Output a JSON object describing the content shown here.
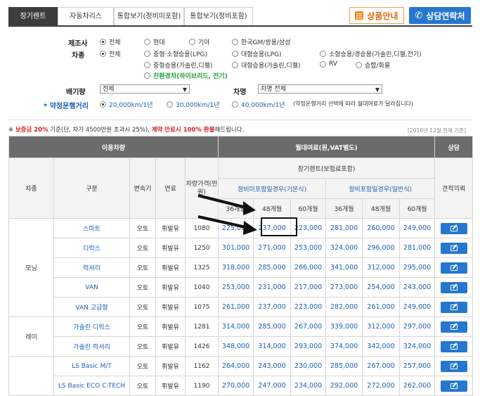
{
  "tabs": [
    {
      "label": "장기렌트",
      "active": true
    },
    {
      "label": "자동차리스",
      "active": false
    },
    {
      "label": "통합보기(정비미포함)",
      "active": false
    },
    {
      "label": "통합보기(정비포함)",
      "active": false
    }
  ],
  "buttons": {
    "product_info": "상품안내",
    "contact": "상담연락처"
  },
  "filters": {
    "maker_label": "제조사",
    "makers": [
      "전체",
      "현대",
      "기아",
      "한국GM/쌍용/삼성"
    ],
    "type_label": "차종",
    "types": [
      "전체",
      "중형·소형승용(LPG)",
      "대형승용(LPG)",
      "소형승용/경승용(가솔린,디젤,전기)",
      "중형승용(가솔린,디젤)",
      "대형승용(가솔린,디젤)",
      "RV",
      "승합/화물",
      "친환경차(하이브리드, 전기)"
    ],
    "displacement_label": "배기량",
    "displacement_value": "전체",
    "model_label": "차명",
    "model_value": "차명 전체",
    "mileage_label": "약정운행거리",
    "mileage_options": [
      "20,000km/1년",
      "30,000km/1년",
      "40,000km/1년"
    ],
    "mileage_note": "(약정운행거리 선택에 따라 월대여료가 달라집니다)"
  },
  "notice": {
    "prefix": "※ ",
    "deposit": "보증금 20%",
    "mid": " 기준(단, 차가 4500만원 초과시 25%), ",
    "refund": "계약 만료시 100% 환불",
    "suffix": "해드립니다.",
    "date": "[2016년 12월 현재 기준]"
  },
  "table": {
    "h_vehicle": "이용차량",
    "h_rent": "월대여료(원,VAT별도)",
    "h_consult": "상담",
    "h_longterm": "장기렌트(보험료포함)",
    "col_type": "차종",
    "col_grade": "구분",
    "col_trans": "변속기",
    "col_fuel": "연료",
    "col_price": "차량가격(만원)",
    "col_no_maint": "정비미포함일경우(기본식)",
    "col_maint": "정비포함일경우(일반식)",
    "col_estimate": "견적의뢰",
    "months": [
      "36개월",
      "48개월",
      "60개월",
      "36개월",
      "48개월",
      "60개월"
    ],
    "groups": [
      {
        "type": "모닝",
        "rows": [
          {
            "grade": "스마트",
            "trans": "오토",
            "fuel": "휘발유",
            "price": "1080",
            "p": [
              "225,000",
              "237,000",
              "223,000",
              "281,000",
              "260,000",
              "249,000"
            ]
          },
          {
            "grade": "디럭스",
            "trans": "오토",
            "fuel": "휘발유",
            "price": "1250",
            "p": [
              "301,000",
              "271,000",
              "253,000",
              "324,000",
              "296,000",
              "281,000"
            ]
          },
          {
            "grade": "럭셔리",
            "trans": "오토",
            "fuel": "휘발유",
            "price": "1325",
            "p": [
              "318,000",
              "285,000",
              "266,000",
              "341,000",
              "312,000",
              "295,000"
            ]
          },
          {
            "grade": "VAN",
            "trans": "오토",
            "fuel": "휘발유",
            "price": "1040",
            "p": [
              "253,000",
              "231,000",
              "217,000",
              "273,000",
              "254,000",
              "243,000"
            ]
          },
          {
            "grade": "VAN 고급형",
            "trans": "오토",
            "fuel": "휘발유",
            "price": "1075",
            "p": [
              "261,000",
              "237,000",
              "223,000",
              "282,000",
              "261,000",
              "249,000"
            ]
          }
        ]
      },
      {
        "type": "레이",
        "rows": [
          {
            "grade": "가솔린 디럭스",
            "trans": "오토",
            "fuel": "휘발유",
            "price": "1281",
            "p": [
              "314,000",
              "285,000",
              "267,000",
              "339,000",
              "312,000",
              "297,000"
            ]
          },
          {
            "grade": "가솔린 럭셔리",
            "trans": "오토",
            "fuel": "휘발유",
            "price": "1426",
            "p": [
              "348,000",
              "314,000",
              "293,000",
              "374,000",
              "342,000",
              "324,000"
            ]
          }
        ]
      },
      {
        "type": "",
        "rows": [
          {
            "grade": "LS Basic M/T",
            "trans": "오토",
            "fuel": "휘발유",
            "price": "1162",
            "p": [
              "264,000",
              "243,000",
              "230,000",
              "285,000",
              "267,000",
              "257,000"
            ]
          },
          {
            "grade": "LS Basic ECO C-TECH",
            "trans": "오토",
            "fuel": "휘발유",
            "price": "1190",
            "p": [
              "270,000",
              "247,000",
              "234,000",
              "292,000",
              "272,000",
              "262,000"
            ]
          }
        ]
      }
    ]
  }
}
